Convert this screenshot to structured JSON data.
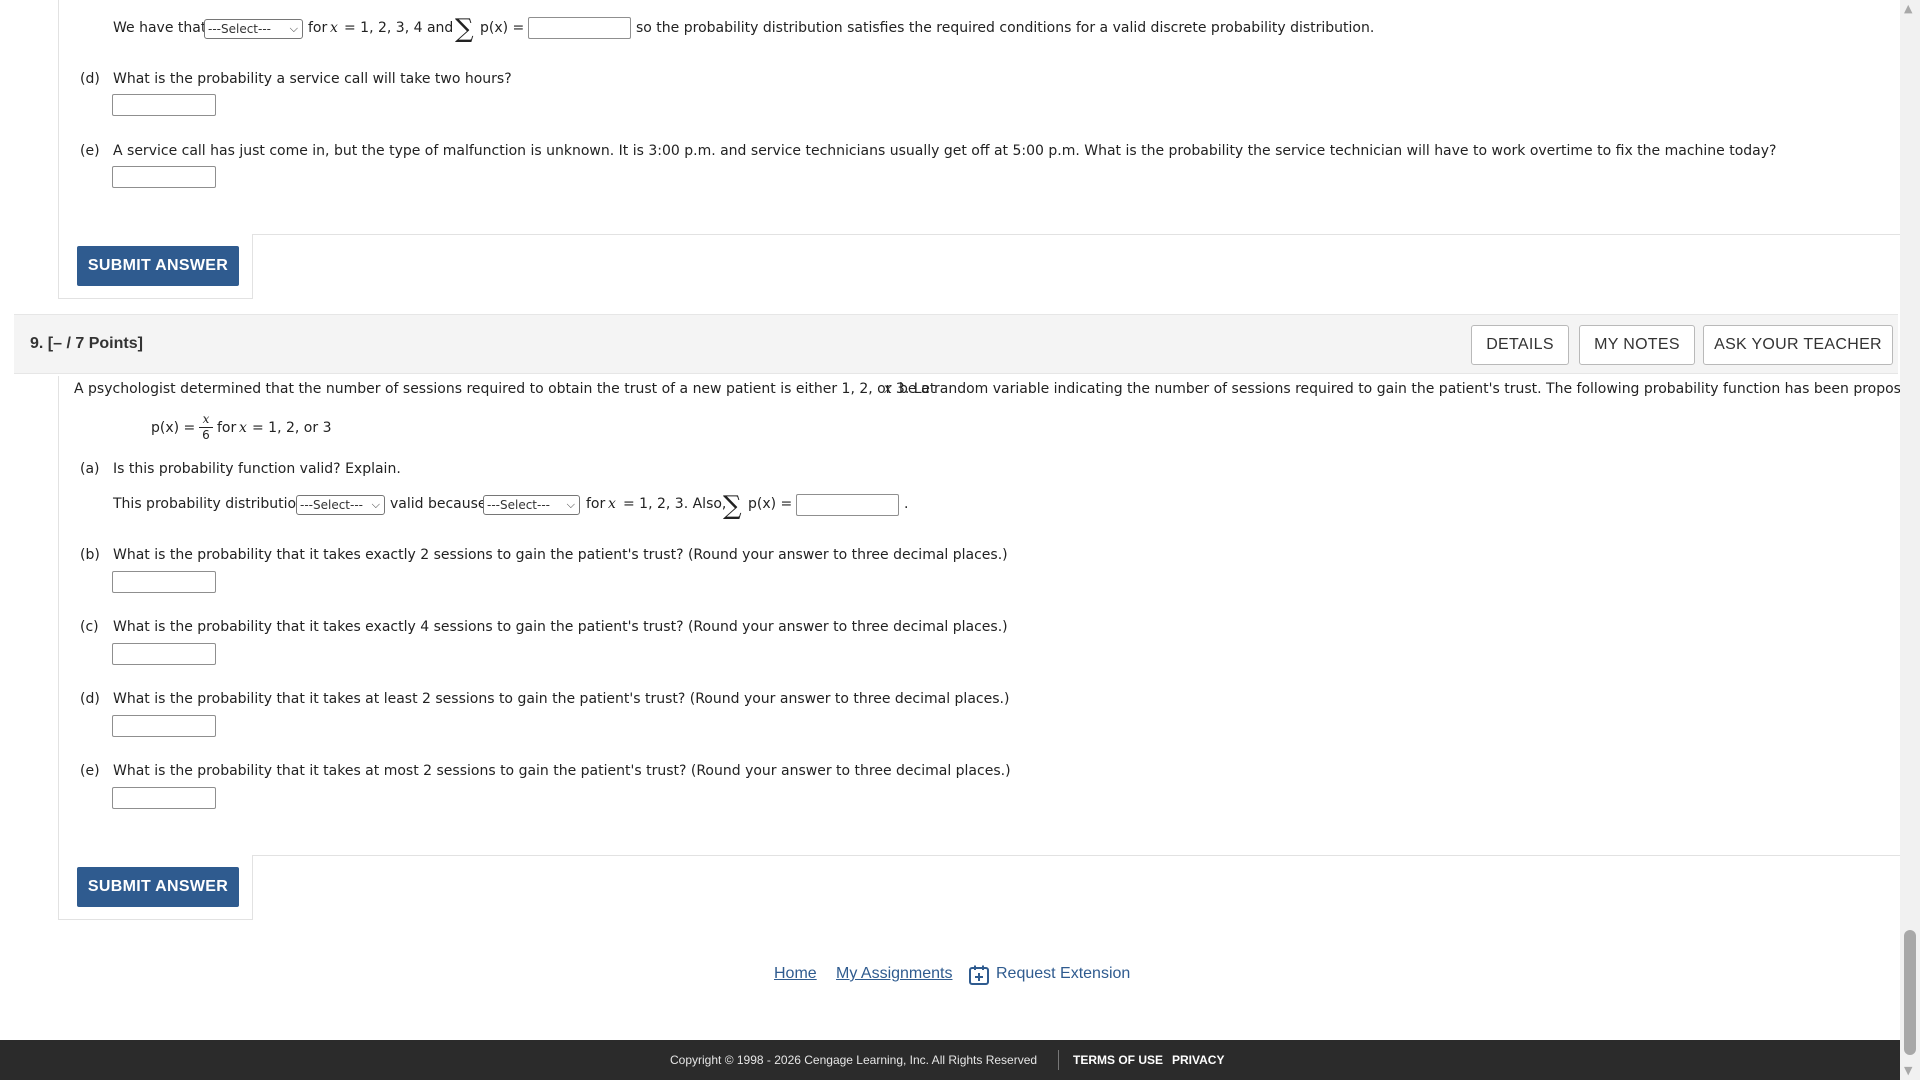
{
  "prev_question": {
    "c_answer": {
      "prefix": "We have that",
      "select_value": "---Select---",
      "for_x": "for",
      "x_var": "x",
      "x_values": "= 1, 2, 3, 4 and",
      "sigma": "∑",
      "px": "p(x) =",
      "suffix": "so the probability distribution satisfies the required conditions for a valid discrete probability distribution."
    },
    "d": {
      "label": "(d)",
      "text": "What is the probability a service call will take two hours?"
    },
    "e": {
      "label": "(e)",
      "text": "A service call has just come in, but the type of malfunction is unknown. It is 3:00 p.m. and service technicians usually get off at 5:00 p.m. What is the probability the service technician will have to work overtime to fix the machine today?"
    },
    "submit_label": "SUBMIT ANSWER"
  },
  "question9": {
    "header": "9.  [– / 7 Points]",
    "buttons": {
      "details": "DETAILS",
      "my_notes": "MY NOTES",
      "ask_teacher": "ASK YOUR TEACHER"
    },
    "intro_a": "A psychologist determined that the number of sessions required to obtain the trust of a new patient is either 1, 2, or 3. Let",
    "intro_x": "x",
    "intro_b": "be a random variable indicating the number of sessions required to gain the patient's trust. The following probability function has been proposed.",
    "formula": {
      "lhs": "p(x) =",
      "num": "x",
      "den": "6",
      "rhs_for": "for",
      "rhs_x": "x",
      "rhs_vals": "= 1, 2, or 3"
    },
    "a": {
      "label": "(a)",
      "text": "Is this probability function valid? Explain.",
      "line_prefix": "This probability distribution",
      "select1": "---Select---",
      "mid": "valid because",
      "select2": "---Select---",
      "for_text": "for",
      "x_var": "x",
      "vals": "= 1, 2, 3. Also,",
      "sigma": "∑",
      "px": "p(x) =",
      "end": "."
    },
    "b": {
      "label": "(b)",
      "text": "What is the probability that it takes exactly 2 sessions to gain the patient's trust? (Round your answer to three decimal places.)"
    },
    "c": {
      "label": "(c)",
      "text": "What is the probability that it takes exactly 4 sessions to gain the patient's trust? (Round your answer to three decimal places.)"
    },
    "d": {
      "label": "(d)",
      "text": "What is the probability that it takes at least 2 sessions to gain the patient's trust? (Round your answer to three decimal places.)"
    },
    "e": {
      "label": "(e)",
      "text": "What is the probability that it takes at most 2 sessions to gain the patient's trust? (Round your answer to three decimal places.)"
    },
    "submit_label": "SUBMIT ANSWER"
  },
  "nav": {
    "home": "Home",
    "my_assignments": "My Assignments",
    "request_extension": "Request Extension"
  },
  "footer": {
    "copyright": "Copyright © 1998 - 2026 Cengage Learning, Inc. All Rights Reserved",
    "terms": "TERMS OF USE",
    "privacy": "PRIVACY"
  },
  "colors": {
    "accent": "#2f5b8f",
    "footer_bg": "#2b2b2b",
    "header_bg": "#f4f4f4"
  }
}
